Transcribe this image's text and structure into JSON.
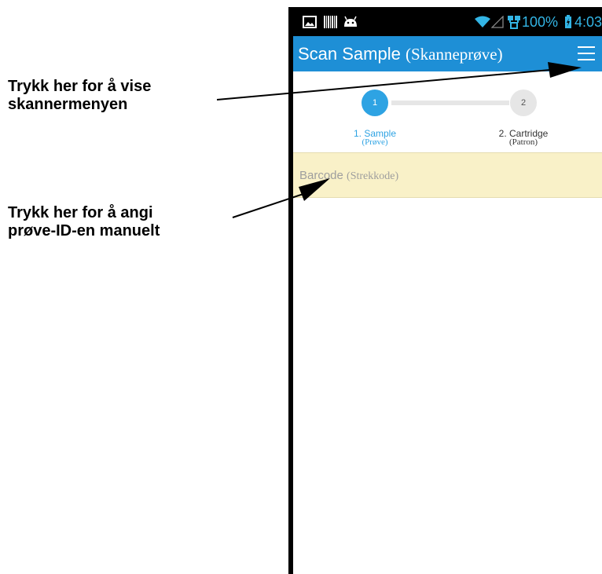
{
  "callouts": {
    "menu": {
      "line1": "Trykk her for å vise",
      "line2": "skannermenyen"
    },
    "barcode": {
      "line1": "Trykk her for å angi",
      "line2": "prøve-ID-en manuelt"
    }
  },
  "status_bar": {
    "battery_percent": "100%",
    "time": "4:03",
    "icons": [
      "image-icon",
      "barcode-icon",
      "android-icon",
      "wifi-icon",
      "signal-icon",
      "network-icon",
      "battery-charging-icon"
    ]
  },
  "app_bar": {
    "title": "Scan Sample",
    "title_translation": "(Skanneprøve)",
    "menu_icon": "hamburger-menu-icon",
    "color": "#1e8fd6"
  },
  "stepper": {
    "steps": [
      {
        "number": "1",
        "label": "1. Sample",
        "translation": "(Prøve)",
        "active": true
      },
      {
        "number": "2",
        "label": "2. Cartridge",
        "translation": "(Patron)",
        "active": false
      }
    ],
    "active_color": "#2ea3e3"
  },
  "barcode_field": {
    "label": "Barcode",
    "translation": "(Strekkode)",
    "background": "#f9f1c8"
  }
}
